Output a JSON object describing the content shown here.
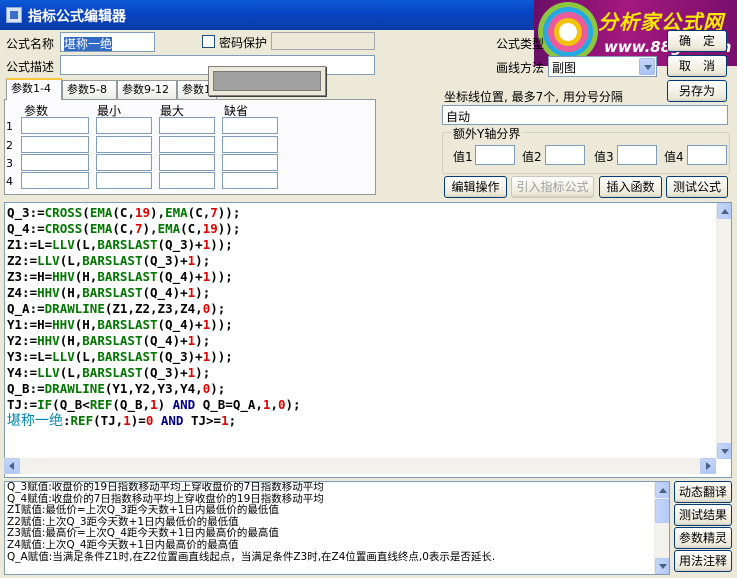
{
  "window": {
    "title": "指标公式编辑器"
  },
  "logo": {
    "title": "分析家公式网",
    "url": "www.88gs.com"
  },
  "form": {
    "name_label": "公式名称",
    "name_value": "堪称一绝",
    "password_label": "密码保护",
    "desc_label": "公式描述",
    "desc_value": "",
    "type_label": "公式类型",
    "draw_label": "画线方法",
    "draw_value": "副图",
    "ok_label": "确　定",
    "cancel_label": "取　消",
    "save_as_label": "另存为"
  },
  "tabs": [
    "参数1-4",
    "参数5-8",
    "参数9-12",
    "参数1"
  ],
  "params": {
    "headers": [
      "参数",
      "最小",
      "最大",
      "缺省"
    ],
    "rows": [
      "1",
      "2",
      "3",
      "4"
    ]
  },
  "coords": {
    "label": "坐标线位置, 最多7个, 用分号分隔",
    "value": "自动"
  },
  "extra_y": {
    "title": "额外Y轴分界",
    "labels": [
      "值1",
      "值2",
      "值3",
      "值4"
    ]
  },
  "actions": {
    "edit": "编辑操作",
    "import": "引入指标公式",
    "insert": "插入函数",
    "test": "测试公式"
  },
  "code_lines": [
    [
      [
        "v",
        "Q_3:="
      ],
      [
        "fn",
        "CROSS"
      ],
      [
        "v",
        "("
      ],
      [
        "fn",
        "EMA"
      ],
      [
        "v",
        "(C,"
      ],
      [
        "num",
        "19"
      ],
      [
        "v",
        "),"
      ],
      [
        "fn",
        "EMA"
      ],
      [
        "v",
        "(C,"
      ],
      [
        "num",
        "7"
      ],
      [
        "v",
        "));"
      ]
    ],
    [
      [
        "v",
        "Q_4:="
      ],
      [
        "fn",
        "CROSS"
      ],
      [
        "v",
        "("
      ],
      [
        "fn",
        "EMA"
      ],
      [
        "v",
        "(C,"
      ],
      [
        "num",
        "7"
      ],
      [
        "v",
        "),"
      ],
      [
        "fn",
        "EMA"
      ],
      [
        "v",
        "(C,"
      ],
      [
        "num",
        "19"
      ],
      [
        "v",
        "));"
      ]
    ],
    [
      [
        "v",
        "Z1:=L="
      ],
      [
        "fn",
        "LLV"
      ],
      [
        "v",
        "(L,"
      ],
      [
        "fn",
        "BARSLAST"
      ],
      [
        "v",
        "(Q_3)+"
      ],
      [
        "num",
        "1"
      ],
      [
        "v",
        "));"
      ]
    ],
    [
      [
        "v",
        "Z2:="
      ],
      [
        "fn",
        "LLV"
      ],
      [
        "v",
        "(L,"
      ],
      [
        "fn",
        "BARSLAST"
      ],
      [
        "v",
        "(Q_3)+"
      ],
      [
        "num",
        "1"
      ],
      [
        "v",
        ");"
      ]
    ],
    [
      [
        "v",
        "Z3:=H="
      ],
      [
        "fn",
        "HHV"
      ],
      [
        "v",
        "(H,"
      ],
      [
        "fn",
        "BARSLAST"
      ],
      [
        "v",
        "(Q_4)+"
      ],
      [
        "num",
        "1"
      ],
      [
        "v",
        "));"
      ]
    ],
    [
      [
        "v",
        "Z4:="
      ],
      [
        "fn",
        "HHV"
      ],
      [
        "v",
        "(H,"
      ],
      [
        "fn",
        "BARSLAST"
      ],
      [
        "v",
        "(Q_4)+"
      ],
      [
        "num",
        "1"
      ],
      [
        "v",
        ");"
      ]
    ],
    [
      [
        "v",
        "Q_A:="
      ],
      [
        "fn",
        "DRAWLINE"
      ],
      [
        "v",
        "(Z1,Z2,Z3,Z4,"
      ],
      [
        "num",
        "0"
      ],
      [
        "v",
        ");"
      ]
    ],
    [
      [
        "v",
        "Y1:=H="
      ],
      [
        "fn",
        "HHV"
      ],
      [
        "v",
        "(H,"
      ],
      [
        "fn",
        "BARSLAST"
      ],
      [
        "v",
        "(Q_4)+"
      ],
      [
        "num",
        "1"
      ],
      [
        "v",
        "));"
      ]
    ],
    [
      [
        "v",
        "Y2:="
      ],
      [
        "fn",
        "HHV"
      ],
      [
        "v",
        "(H,"
      ],
      [
        "fn",
        "BARSLAST"
      ],
      [
        "v",
        "(Q_4)+"
      ],
      [
        "num",
        "1"
      ],
      [
        "v",
        ");"
      ]
    ],
    [
      [
        "v",
        "Y3:=L="
      ],
      [
        "fn",
        "LLV"
      ],
      [
        "v",
        "(L,"
      ],
      [
        "fn",
        "BARSLAST"
      ],
      [
        "v",
        "(Q_3)+"
      ],
      [
        "num",
        "1"
      ],
      [
        "v",
        "));"
      ]
    ],
    [
      [
        "v",
        "Y4:="
      ],
      [
        "fn",
        "LLV"
      ],
      [
        "v",
        "(L,"
      ],
      [
        "fn",
        "BARSLAST"
      ],
      [
        "v",
        "(Q_3)+"
      ],
      [
        "num",
        "1"
      ],
      [
        "v",
        ");"
      ]
    ],
    [
      [
        "v",
        "Q_B:="
      ],
      [
        "fn",
        "DRAWLINE"
      ],
      [
        "v",
        "(Y1,Y2,Y3,Y4,"
      ],
      [
        "num",
        "0"
      ],
      [
        "v",
        ");"
      ]
    ],
    [
      [
        "v",
        "TJ:="
      ],
      [
        "fn",
        "IF"
      ],
      [
        "v",
        "(Q_B<"
      ],
      [
        "fn",
        "REF"
      ],
      [
        "v",
        "(Q_B,"
      ],
      [
        "num",
        "1"
      ],
      [
        "v",
        ") "
      ],
      [
        "kw",
        "AND"
      ],
      [
        "v",
        " Q_B=Q_A,"
      ],
      [
        "num",
        "1"
      ],
      [
        "v",
        ","
      ],
      [
        "num",
        "0"
      ],
      [
        "v",
        ");"
      ]
    ],
    [
      [
        "cn",
        "堪称一绝"
      ],
      [
        "v",
        ":"
      ],
      [
        "fn",
        "REF"
      ],
      [
        "v",
        "(TJ,"
      ],
      [
        "num",
        "1"
      ],
      [
        "v",
        ")="
      ],
      [
        "num",
        "0"
      ],
      [
        "v",
        " "
      ],
      [
        "kw",
        "AND"
      ],
      [
        "v",
        " TJ>="
      ],
      [
        "num",
        "1"
      ],
      [
        "v",
        ";"
      ]
    ]
  ],
  "descriptions": [
    "Q_3赋值:收盘价的19日指数移动平均上穿收盘价的7日指数移动平均",
    "Q_4赋值:收盘价的7日指数移动平均上穿收盘价的19日指数移动平均",
    "Z1赋值:最低价=上次Q_3距今天数+1日内最低价的最低值",
    "Z2赋值:上次Q_3距今天数+1日内最低价的最低值",
    "Z3赋值:最高价=上次Q_4距今天数+1日内最高价的最高值",
    "Z4赋值:上次Q_4距今天数+1日内最高价的最高值",
    "Q_A赋值:当满足条件Z1时,在Z2位置画直线起点，当满足条件Z3时,在Z4位置画直线终点,0表示是否延长."
  ],
  "side_buttons": [
    "动态翻译",
    "测试结果",
    "参数精灵",
    "用法注释"
  ]
}
